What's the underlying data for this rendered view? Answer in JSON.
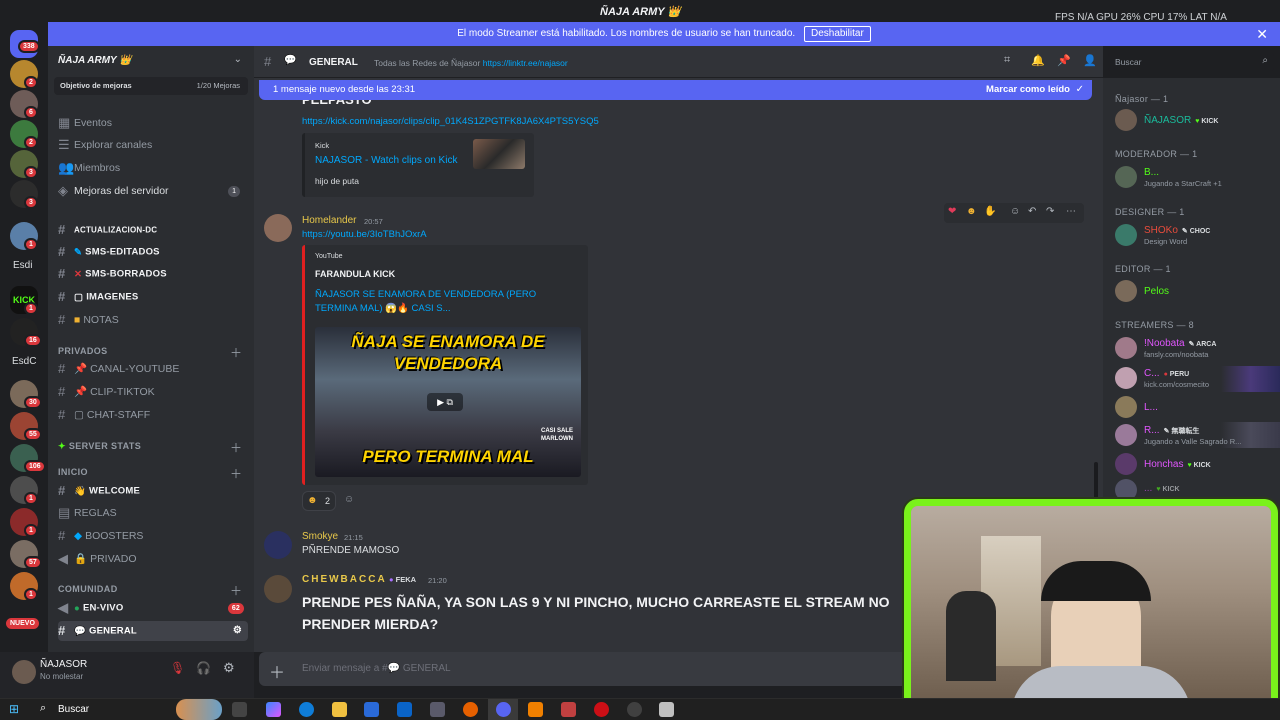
{
  "titlebar": {
    "title": "ÑAJA ARMY 👑",
    "overlay": "FPS N/A  GPU 26%  CPU 17%  LAT N/A"
  },
  "streamer_banner": {
    "text": "El modo Streamer está habilitado. Los nombres de usuario se han truncado.",
    "button": "Deshabilitar"
  },
  "servers": {
    "badges": [
      "338",
      "2",
      "6",
      "2",
      "3",
      "3",
      "1",
      "1",
      "16",
      "30",
      "55",
      "106",
      "1",
      "1",
      "57",
      "1"
    ],
    "labels": [
      "Esdi",
      "EsdC"
    ],
    "new_label": "NUEVO"
  },
  "guild": {
    "name": "ÑAJA ARMY 👑",
    "boost_label": "Objetivo de mejoras",
    "boost_count": "1/20 Mejoras"
  },
  "nav": {
    "events": "Eventos",
    "explore": "Explorar canales",
    "members": "Miembros",
    "boosts": "Mejoras del servidor",
    "boosts_badge": "1"
  },
  "channels": {
    "top": [
      "ACTUALIZACION-DC",
      "SMS-EDITADOS",
      "SMS-BORRADOS",
      "IMAGENES",
      "NOTAS"
    ],
    "cat_privados": "PRIVADOS",
    "privados": [
      "CANAL-YOUTUBE",
      "CLIP-TIKTOK",
      "CHAT-STAFF"
    ],
    "cat_stats": "SERVER STATS",
    "cat_inicio": "INICIO",
    "inicio": [
      "WELCOME",
      "REGLAS",
      "BOOSTERS",
      "PRIVADO"
    ],
    "cat_comunidad": "COMUNIDAD",
    "comunidad": [
      "EN-VIVO",
      "GENERAL"
    ],
    "envivo_badge": "62"
  },
  "user": {
    "name": "ÑAJASOR",
    "status": "No molestar"
  },
  "header": {
    "channel": "GENERAL",
    "topic": "Todas las Redes de Ñajasor",
    "topic_link": "https://linktr.ee/najasor",
    "search_placeholder": "Buscar"
  },
  "new_messages": {
    "text": "1 mensaje nuevo desde las 23:31",
    "action": "Marcar como leído"
  },
  "messages": {
    "m0": {
      "partial": "PEEPASTO",
      "link": "https://kick.com/najasor/clips/clip_01K4S1ZPGTFK8JA6X4PTS5YSQ5",
      "embed_provider": "Kick",
      "embed_title": "NAJASOR - Watch clips on Kick",
      "embed_desc": "hijo de puta"
    },
    "m1": {
      "author": "Homelander",
      "time": "20:57",
      "link": "https://youtu.be/3IoTBhJOxrA",
      "provider": "YouTube",
      "channel": "FARANDULA KICK",
      "title": "ÑAJASOR SE ENAMORA DE VENDEDORA (PERO TERMINA MAL) 😱🔥 CASI S...",
      "thumb_top": "ÑAJA SE ENAMORA DE VENDEDORA",
      "thumb_bottom": "PERO TERMINA MAL",
      "thumb_corner": "CASI SALE MARLOWN",
      "reaction_count": "2"
    },
    "m2": {
      "author": "Smokye",
      "time": "21:15",
      "text": "PÑRENDE MAMOSO"
    },
    "m3": {
      "author": "CHEWBACCA",
      "tag": "FEKA",
      "time": "21:20",
      "text": "PRENDE  PES ÑAÑA, YA SON LAS 9 Y NI PINCHO, MUCHO CARREASTE EL STREAM NO PRENDER MIERDA?"
    }
  },
  "composer": {
    "placeholder": "Enviar mensaje a #💬 GENERAL"
  },
  "members": {
    "h1": "Ñajasor — 1",
    "h2": "MODERADOR — 1",
    "h3": "DESIGNER — 1",
    "h4": "EDITOR — 1",
    "h5": "STREAMERS — 8",
    "list": [
      {
        "name": "ÑAJASOR",
        "tag": "KICK",
        "sub": ""
      },
      {
        "name": "B...",
        "tag": "",
        "sub": "Jugando a StarCraft +1"
      },
      {
        "name": "SHOKo",
        "tag": "CHOC",
        "sub": "Design Word"
      },
      {
        "name": "Pelos",
        "tag": "",
        "sub": ""
      },
      {
        "name": "!Noobata",
        "tag": "ARCA",
        "sub": "fansly.com/noobata"
      },
      {
        "name": "C...",
        "tag": "PERU",
        "sub": "kick.com/cosmecito"
      },
      {
        "name": "L...",
        "tag": "",
        "sub": ""
      },
      {
        "name": "R...",
        "tag": "無職転生",
        "sub": "Jugando a Valle Sagrado R..."
      },
      {
        "name": "Honchas",
        "tag": "KICK",
        "sub": ""
      },
      {
        "name": "...",
        "tag": "KICK",
        "sub": ""
      }
    ]
  },
  "taskbar": {
    "search": "Buscar"
  },
  "colors": {
    "accent": "#5865f2",
    "webcam_border": "#7af21b",
    "author_yellow": "#e8c84a"
  }
}
